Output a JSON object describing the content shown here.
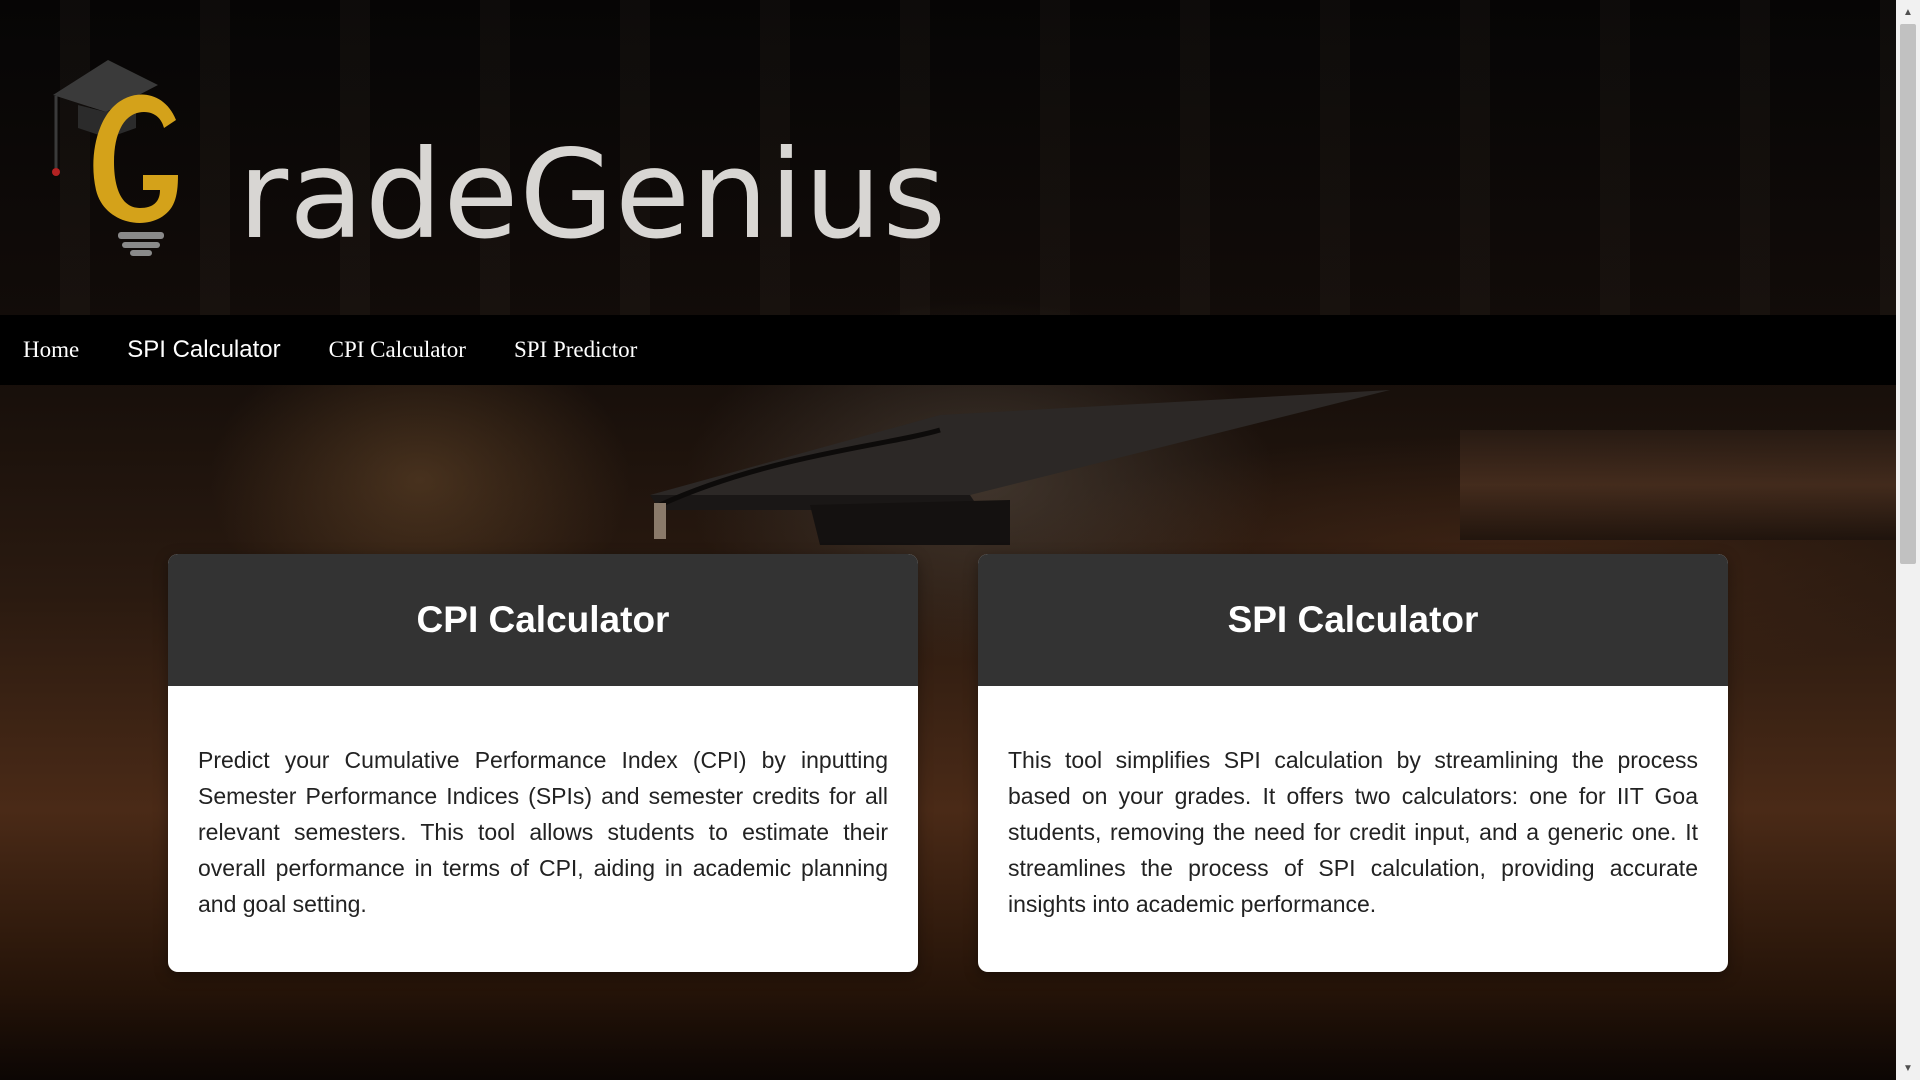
{
  "brand": {
    "name": "GradeGenius",
    "accent_color": "#d4a21a",
    "text_color": "#d8d6d3",
    "icon": "graduation-cap-lightbulb-icon"
  },
  "nav": {
    "items": [
      {
        "label": "Home"
      },
      {
        "label": "SPI Calculator"
      },
      {
        "label": "CPI Calculator"
      },
      {
        "label": "SPI Predictor"
      }
    ]
  },
  "cards": [
    {
      "title": "CPI Calculator",
      "body": "Predict your Cumulative Performance Index (CPI) by inputting Semester Performance Indices (SPIs) and semester credits for all relevant semesters. This tool allows students to estimate their overall performance in terms of CPI, aiding in academic planning and goal setting."
    },
    {
      "title": "SPI Calculator",
      "body": "This tool simplifies SPI calculation by streamlining the process based on your grades. It offers two calculators: one for IIT Goa students, removing the need for credit input, and a generic one. It streamlines the process of SPI calculation, providing accurate insights into academic performance."
    }
  ],
  "colors": {
    "card_header": "#333333",
    "nav_bg": "#000000"
  }
}
